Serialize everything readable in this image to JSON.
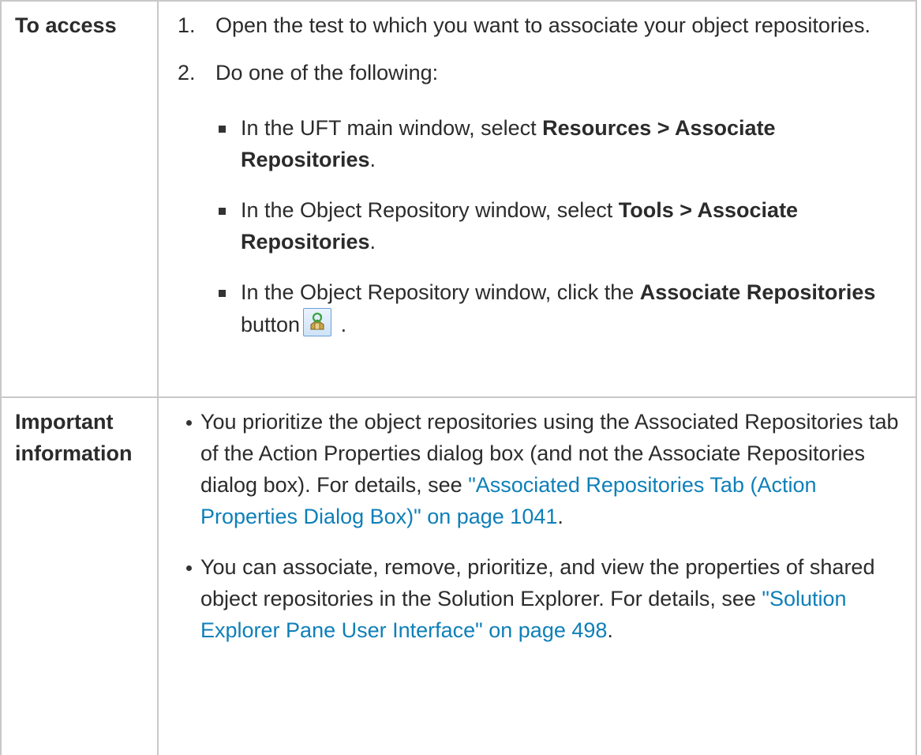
{
  "rows": {
    "access": {
      "label": "To access",
      "steps": [
        {
          "number": "1.",
          "text": "Open the test to which you want to associate your object repositories."
        },
        {
          "number": "2.",
          "text": "Do one of the following:"
        }
      ],
      "options": [
        {
          "prefix": "In the UFT main window, select ",
          "path": "Resources > Associate Repositories",
          "suffix": "."
        },
        {
          "prefix": "In the Object Repository window, select ",
          "path": "Tools > Associate Repositories",
          "suffix": "."
        },
        {
          "prefix": "In the Object Repository window, click the ",
          "path": "Associate Repositories",
          "suffix_before_icon": " button",
          "suffix": " ."
        }
      ],
      "button_icon": "associate-repositories-icon"
    },
    "important": {
      "label": "Important information",
      "bullets": [
        {
          "text": "You prioritize the object repositories using the Associated Repositories tab of the Action Properties dialog box (and not the Associate Repositories dialog box). For details, see ",
          "link": "\"Associated Repositories Tab (Action Properties Dialog Box)\" on page 1041",
          "suffix": "."
        },
        {
          "text": "You can associate, remove, prioritize, and view the properties of shared object repositories in the Solution Explorer. For details, see ",
          "link": "\"Solution Explorer Pane User Interface\" on page 498",
          "suffix": "."
        }
      ]
    }
  },
  "colors": {
    "link": "#0e7fb8",
    "border": "#c8c8c8",
    "text": "#2b2b2b"
  }
}
